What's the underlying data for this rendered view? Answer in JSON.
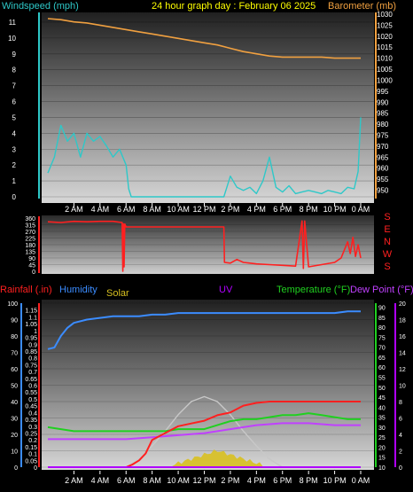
{
  "header": {
    "windspeed_label": "Windspeed (mph)",
    "title": "24 hour graph day : February 06 2025",
    "barometer_label": "Barometer (mb)"
  },
  "bottom_header": {
    "rainfall_label": "Rainfall (.in)",
    "humidity_label": "Humidity",
    "solar_label": "Solar",
    "uv_label": "UV",
    "temperature_label": "Temperature (°F)",
    "dewpoint_label": "Dew Point (°F)"
  },
  "compass": [
    "S",
    "E",
    "N",
    "W",
    "S"
  ],
  "colors": {
    "wind": "#2ec8c8",
    "barometer": "#f0a040",
    "direction": "#ff2020",
    "rain": "#ff2020",
    "humidity": "#3b8cff",
    "solar_curve": "#c8c8c8",
    "solar_fill": "#d8c020",
    "uv": "#b000ff",
    "temperature": "#20d020",
    "dewpoint": "#c040ff",
    "temp_chill": "#d8f0b0",
    "title": "#ffff00"
  },
  "chart_data": [
    {
      "type": "line",
      "name": "wind-barometer",
      "x_ticks": [
        "2 AM",
        "4 AM",
        "6 AM",
        "8 AM",
        "10 AM",
        "12 PM",
        "2 PM",
        "4 PM",
        "6 PM",
        "8 PM",
        "10 PM",
        "0 AM"
      ],
      "left_axis": {
        "label": "Windspeed (mph)",
        "ylim": [
          0,
          11.5
        ],
        "ticks": [
          0,
          1,
          2,
          3,
          4,
          5,
          6,
          7,
          8,
          9,
          10,
          11
        ]
      },
      "right_axis": {
        "label": "Barometer (mb)",
        "ylim": [
          947,
          1030
        ],
        "ticks": [
          950,
          955,
          960,
          965,
          970,
          975,
          980,
          985,
          990,
          995,
          1000,
          1005,
          1010,
          1015,
          1020,
          1025,
          1030
        ]
      },
      "series": [
        {
          "name": "Windspeed (mph)",
          "axis": "left",
          "x": [
            0,
            0.5,
            1,
            1.5,
            2,
            2.5,
            3,
            3.5,
            4,
            4.5,
            5,
            5.5,
            6,
            6.2,
            6.4,
            8,
            10,
            12,
            13.5,
            14,
            14.5,
            15,
            15.5,
            16,
            16.5,
            17,
            17.5,
            18,
            18.5,
            19,
            19.5,
            20,
            20.5,
            21,
            21.5,
            22,
            22.5,
            23,
            23.5,
            23.8,
            24
          ],
          "y": [
            1.5,
            2.5,
            4.5,
            3.5,
            4.0,
            2.5,
            4.0,
            3.5,
            3.8,
            3.2,
            2.5,
            3.0,
            2.0,
            0.5,
            0.0,
            0.0,
            0.0,
            0.0,
            0.0,
            1.3,
            0.6,
            0.4,
            0.6,
            0.2,
            1.0,
            2.5,
            0.6,
            0.3,
            0.7,
            0.2,
            0.3,
            0.4,
            0.3,
            0.2,
            0.4,
            0.3,
            0.2,
            0.6,
            0.5,
            1.6,
            5.0
          ]
        },
        {
          "name": "Barometer (mb)",
          "axis": "right",
          "x": [
            0,
            1,
            2,
            3,
            4,
            5,
            6,
            7,
            8,
            9,
            10,
            11,
            12,
            13,
            14,
            15,
            16,
            17,
            18,
            19,
            20,
            21,
            22,
            23,
            24
          ],
          "y": [
            1028,
            1027.5,
            1026.5,
            1026,
            1025,
            1024,
            1023,
            1022,
            1021,
            1020,
            1019,
            1018,
            1017,
            1016,
            1014.5,
            1013,
            1012,
            1011,
            1010.5,
            1010.5,
            1010.5,
            1010.5,
            1010,
            1010,
            1010
          ]
        }
      ]
    },
    {
      "type": "line",
      "name": "wind-direction",
      "x_ticks": [],
      "left_axis": {
        "label": "",
        "ylim": [
          0,
          360
        ],
        "ticks": [
          0,
          45,
          90,
          135,
          180,
          225,
          270,
          315,
          360
        ]
      },
      "right_axis": {
        "label": "",
        "ticks": [
          "S",
          "E",
          "N",
          "W",
          "S"
        ]
      },
      "series": [
        {
          "name": "Wind direction",
          "x": [
            0,
            1,
            2,
            3,
            4,
            5,
            5.7,
            5.75,
            5.8,
            5.85,
            5.9,
            6,
            7,
            10,
            13.5,
            13.55,
            14,
            14.5,
            15,
            15.5,
            16,
            17,
            18,
            19,
            19.5,
            19.6,
            19.7,
            20,
            21,
            22,
            22.5,
            23,
            23.2,
            23.4,
            23.6,
            23.8,
            24
          ],
          "y": [
            335,
            330,
            338,
            335,
            338,
            338,
            330,
            0,
            320,
            30,
            320,
            300,
            300,
            300,
            300,
            60,
            55,
            80,
            60,
            55,
            50,
            45,
            40,
            35,
            340,
            20,
            340,
            30,
            45,
            60,
            90,
            200,
            120,
            230,
            100,
            180,
            90
          ]
        }
      ]
    },
    {
      "type": "line",
      "name": "rain-humidity-temperature",
      "x_ticks": [
        "2 AM",
        "4 AM",
        "6 AM",
        "8 AM",
        "10 AM",
        "12 PM",
        "2 PM",
        "4 PM",
        "6 PM",
        "8 PM",
        "10 PM",
        "0 AM"
      ],
      "rain_axis": {
        "label": "Rainfall (.in)",
        "ylim": [
          0,
          1.2
        ],
        "ticks": [
          0,
          0.05,
          0.1,
          0.15,
          0.2,
          0.25,
          0.3,
          0.35,
          0.4,
          0.45,
          0.5,
          0.55,
          0.6,
          0.65,
          0.7,
          0.75,
          0.8,
          0.85,
          0.9,
          0.95,
          1,
          1.05,
          1.1,
          1.15
        ]
      },
      "humidity_axis": {
        "label": "Humidity",
        "ylim": [
          0,
          100
        ],
        "ticks": [
          0,
          10,
          20,
          30,
          40,
          50,
          60,
          70,
          80,
          90,
          100
        ]
      },
      "temperature_axis": {
        "label": "Temperature (°F)",
        "ylim": [
          10,
          92
        ],
        "ticks": [
          10,
          15,
          20,
          25,
          30,
          35,
          40,
          45,
          50,
          55,
          60,
          65,
          70,
          75,
          80,
          85,
          90
        ]
      },
      "uv_axis": {
        "label": "UV",
        "ylim": [
          0,
          20
        ],
        "ticks": [
          0,
          2,
          4,
          6,
          8,
          10,
          12,
          14,
          16,
          18,
          20
        ]
      },
      "series": [
        {
          "name": "Humidity",
          "axis": "humidity",
          "x": [
            0,
            0.5,
            1,
            1.5,
            2,
            3,
            4,
            5,
            6,
            7,
            8,
            9,
            10,
            11,
            12,
            14,
            16,
            18,
            20,
            22,
            23,
            24
          ],
          "y": [
            72,
            73,
            80,
            85,
            88,
            90,
            91,
            92,
            92,
            92,
            93,
            93,
            94,
            94,
            94,
            94,
            94,
            94,
            94,
            94,
            95,
            95
          ]
        },
        {
          "name": "Rainfall (.in)",
          "axis": "rain",
          "x": [
            0,
            6,
            6.5,
            7,
            7.5,
            8,
            9,
            10,
            11,
            12,
            13,
            14,
            15,
            16,
            17,
            18,
            20,
            22,
            24
          ],
          "y": [
            0,
            0,
            0.02,
            0.05,
            0.1,
            0.2,
            0.25,
            0.3,
            0.32,
            0.34,
            0.38,
            0.4,
            0.45,
            0.47,
            0.48,
            0.48,
            0.48,
            0.48,
            0.48
          ]
        },
        {
          "name": "Temperature (°F)",
          "axis": "temperature",
          "x": [
            0,
            1,
            2,
            3,
            4,
            5,
            6,
            7,
            8,
            9,
            10,
            11,
            12,
            13,
            14,
            15,
            16,
            17,
            18,
            19,
            20,
            21,
            22,
            23,
            24
          ],
          "y": [
            30,
            29,
            28,
            28,
            28,
            28,
            28,
            28,
            28,
            28,
            29,
            29,
            29,
            31,
            33,
            34,
            34,
            35,
            36,
            36,
            37,
            36,
            35,
            34,
            34
          ]
        },
        {
          "name": "Dew Point (°F)",
          "axis": "temperature",
          "x": [
            0,
            2,
            4,
            6,
            8,
            10,
            12,
            14,
            16,
            18,
            20,
            22,
            24
          ],
          "y": [
            24,
            24,
            24,
            24,
            25,
            26,
            27,
            29,
            31,
            32,
            32,
            31,
            31
          ]
        },
        {
          "name": "Solar",
          "axis": "humidity",
          "x": [
            6,
            7,
            8,
            9,
            10,
            11,
            12,
            13,
            14,
            15,
            16,
            17,
            18
          ],
          "y": [
            0,
            5,
            13,
            22,
            32,
            40,
            43,
            40,
            32,
            22,
            13,
            5,
            0
          ]
        },
        {
          "name": "UV",
          "axis": "uv",
          "x": [
            0,
            24
          ],
          "y": [
            0,
            0
          ]
        }
      ]
    }
  ]
}
